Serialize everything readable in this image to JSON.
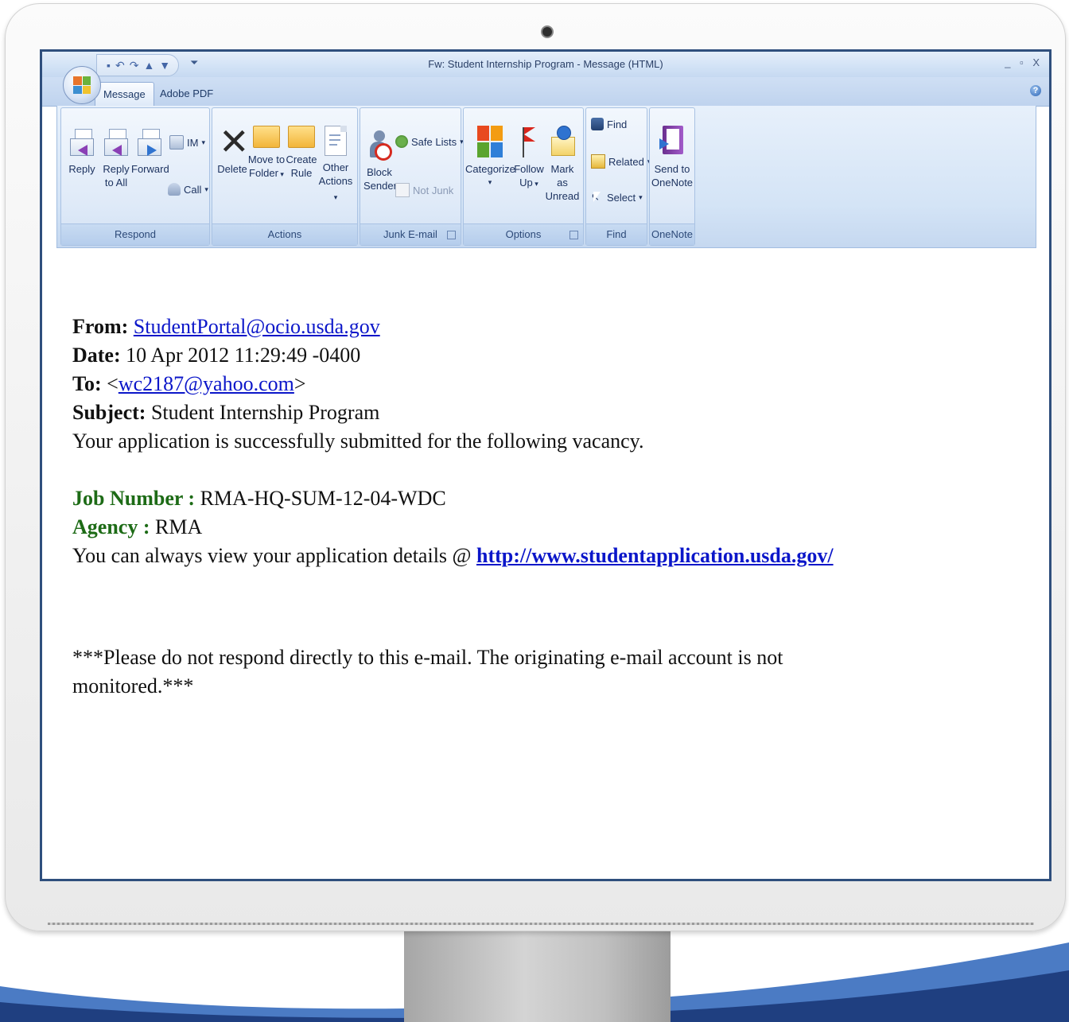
{
  "window": {
    "title": "Fw: Student Internship Program - Message (HTML)",
    "controls": "_ ▫ X"
  },
  "tabs": [
    {
      "label": "Message",
      "active": true
    },
    {
      "label": "Adobe PDF",
      "active": false
    }
  ],
  "ribbon": {
    "groups": [
      {
        "label": "Respond"
      },
      {
        "label": "Actions"
      },
      {
        "label": "Junk E-mail"
      },
      {
        "label": "Options"
      },
      {
        "label": "Find"
      },
      {
        "label": "OneNote"
      }
    ],
    "buttons": {
      "reply": "Reply",
      "reply_all_1": "Reply",
      "reply_all_2": "to All",
      "forward": "Forward",
      "im": "IM",
      "call": "Call",
      "delete": "Delete",
      "move_1": "Move to",
      "move_2": "Folder",
      "create_1": "Create",
      "create_2": "Rule",
      "other_1": "Other",
      "other_2": "Actions",
      "block_1": "Block",
      "block_2": "Sender",
      "safe_lists": "Safe Lists",
      "not_junk": "Not Junk",
      "categorize": "Categorize",
      "follow_1": "Follow",
      "follow_2": "Up",
      "mark_1": "Mark as",
      "mark_2": "Unread",
      "find": "Find",
      "related": "Related",
      "select": "Select",
      "onenote_1": "Send to",
      "onenote_2": "OneNote"
    }
  },
  "email": {
    "from_label": "From:",
    "from_value": "StudentPortal@ocio.usda.gov",
    "date_label": "Date:",
    "date_value": "10 Apr 2012 11:29:49 -0400",
    "to_label": "To:",
    "to_open": "<",
    "to_value": "wc2187@yahoo.com",
    "to_close": ">",
    "subject_label": "Subject:",
    "subject_value": "Student Internship Program",
    "body_line": "Your application is successfully submitted for the following vacancy.",
    "job_label": "Job Number :",
    "job_value": "RMA-HQ-SUM-12-04-WDC",
    "agency_label": "Agency :",
    "agency_value": "RMA",
    "view_text": "You can always view your application details @",
    "view_link": "http://www.studentapplication.usda.gov/",
    "footer_line1": "***Please do not respond directly to this e-mail. The originating e-mail account is not",
    "footer_line2": "monitored.***"
  },
  "colors": {
    "frame_blue": "#2f4f7d",
    "link_blue": "#0b16c9",
    "label_green": "#1d6b16"
  }
}
